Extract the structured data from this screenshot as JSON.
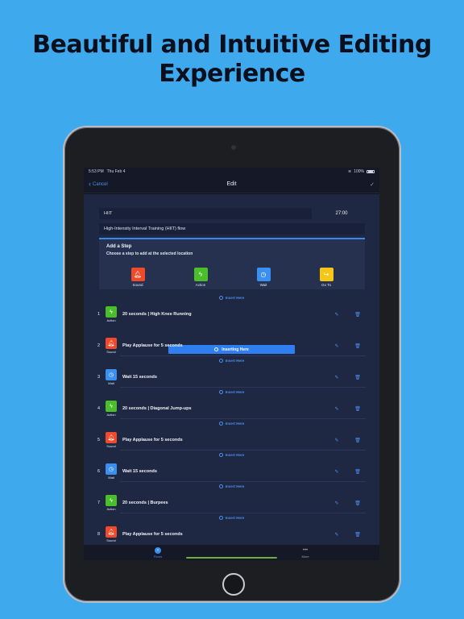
{
  "headline": {
    "line1": "Beautiful and Intuitive Editing",
    "line2": "Experience"
  },
  "status": {
    "time": "5:53 PM",
    "date": "Thu Feb 4",
    "battery": "100%"
  },
  "nav": {
    "cancel": "Cancel",
    "title": "Edit"
  },
  "flow": {
    "name": "HIIT",
    "duration": "27:00",
    "description": "High-Intensity Interval Training (HIIT) flow"
  },
  "add_step": {
    "title": "Add a Step",
    "subtitle": "Choose a step to add at the selected location",
    "choices": [
      {
        "label": "Sound",
        "icon": "bell-icon",
        "color": "#f04a2a"
      },
      {
        "label": "Action",
        "icon": "bolt-icon",
        "color": "#4bbf2a"
      },
      {
        "label": "Wait",
        "icon": "clock-icon",
        "color": "#3a8ff2"
      },
      {
        "label": "Go To",
        "icon": "goto-icon",
        "color": "#f5c518"
      }
    ]
  },
  "insert_here": "Insert Here",
  "inserting_here": "Inserting Here",
  "steps": [
    {
      "num": "1",
      "type": "Action",
      "title": "20 seconds | High Knee Running"
    },
    {
      "num": "2",
      "type": "Sound",
      "title": "Play Applause for 5 seconds"
    },
    {
      "num": "3",
      "type": "Wait",
      "title": "Wait 15 seconds"
    },
    {
      "num": "4",
      "type": "Action",
      "title": "20 seconds | Diagonal Jump-ups"
    },
    {
      "num": "5",
      "type": "Sound",
      "title": "Play Applause for 5 seconds"
    },
    {
      "num": "6",
      "type": "Wait",
      "title": "Wait 15 seconds"
    },
    {
      "num": "7",
      "type": "Action",
      "title": "20 seconds | Burpees"
    },
    {
      "num": "8",
      "type": "Sound",
      "title": "Play Applause for 5 seconds"
    }
  ],
  "tabs": [
    {
      "label": "Flows"
    },
    {
      "label": "More"
    }
  ],
  "colors": {
    "accent": "#3a8ff2",
    "background": "#3fa9ee"
  }
}
